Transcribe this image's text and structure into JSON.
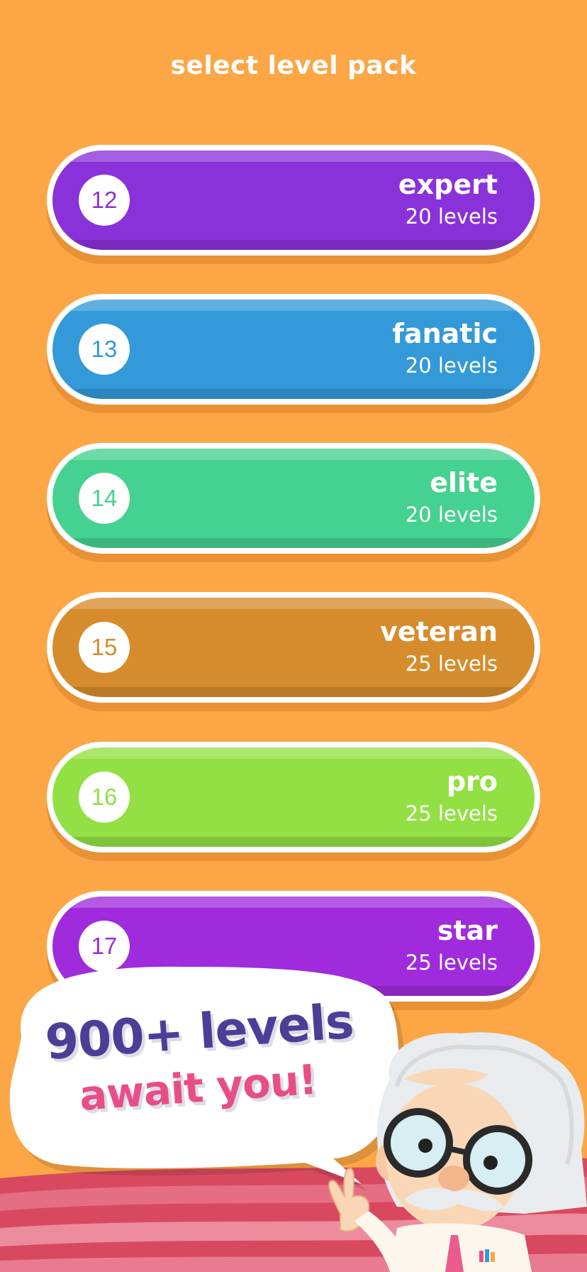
{
  "header": {
    "title": "select level pack"
  },
  "packs": [
    {
      "number": "12",
      "name": "expert",
      "count": "20 levels",
      "color": "#8A32D9",
      "num_color": "#8A32D9"
    },
    {
      "number": "13",
      "name": "fanatic",
      "count": "20 levels",
      "color": "#3399D9",
      "num_color": "#3399D9"
    },
    {
      "number": "14",
      "name": "elite",
      "count": "20 levels",
      "color": "#45D18F",
      "num_color": "#45D18F"
    },
    {
      "number": "15",
      "name": "veteran",
      "count": "25 levels",
      "color": "#D68C2C",
      "num_color": "#D68C2C"
    },
    {
      "number": "16",
      "name": "pro",
      "count": "25 levels",
      "color": "#92E043",
      "num_color": "#92E043"
    },
    {
      "number": "17",
      "name": "star",
      "count": "25 levels",
      "color": "#9F2BDD",
      "num_color": "#9F2BDD"
    }
  ],
  "promo": {
    "line1": "900+ levels",
    "line2": "await you!"
  },
  "colors": {
    "background": "#FCA646",
    "promo_line1": "#4C3E96",
    "promo_line2": "#E84E85"
  }
}
